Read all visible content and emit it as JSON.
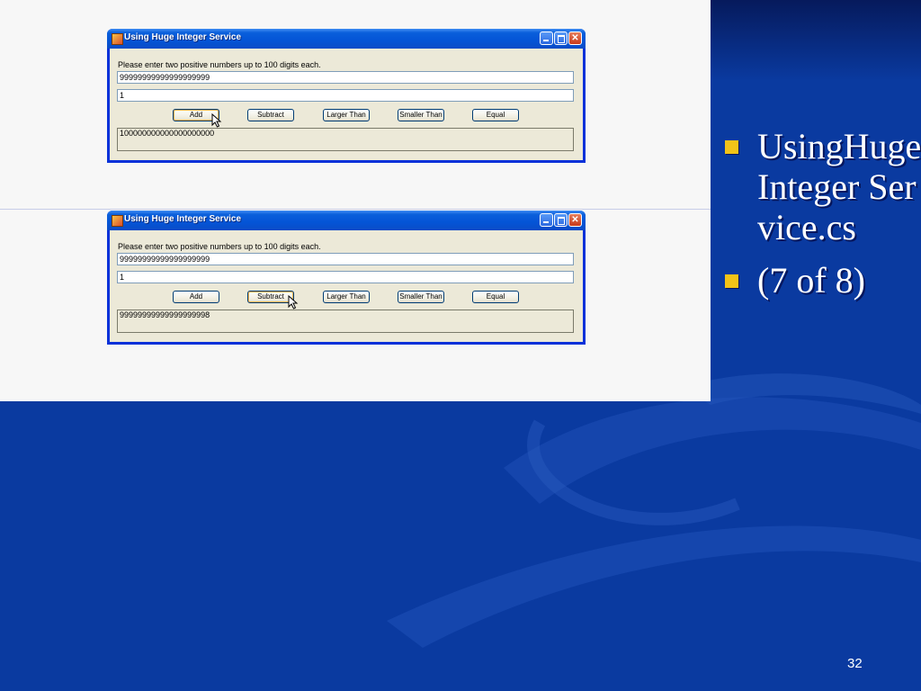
{
  "slide": {
    "bullets": [
      {
        "text": "UsingHugeInteger Service.cs"
      },
      {
        "text": "(7 of 8)"
      }
    ],
    "page_number": "32",
    "colors": {
      "background": "#0a3aa0",
      "bullet": "#f2c318",
      "panel": "#f7f7f7"
    }
  },
  "windows": [
    {
      "title": "Using Huge Integer Service",
      "prompt": "Please enter two positive numbers up to 100 digits each.",
      "input1": "99999999999999999999",
      "input2": "1",
      "buttons": {
        "add": "Add",
        "subtract": "Subtract",
        "larger": "Larger Than",
        "smaller": "Smaller Than",
        "equal": "Equal"
      },
      "result": "100000000000000000000",
      "focused_button": "add"
    },
    {
      "title": "Using Huge Integer Service",
      "prompt": "Please enter two positive numbers up to 100 digits each.",
      "input1": "99999999999999999999",
      "input2": "1",
      "buttons": {
        "add": "Add",
        "subtract": "Subtract",
        "larger": "Larger Than",
        "smaller": "Smaller Than",
        "equal": "Equal"
      },
      "result": "99999999999999999998",
      "focused_button": "subtract"
    }
  ]
}
